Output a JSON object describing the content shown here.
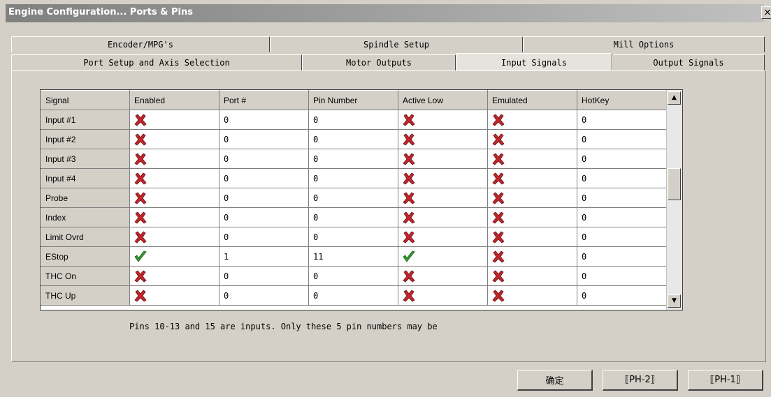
{
  "window": {
    "title": "Engine Configuration... Ports & Pins",
    "close": "×"
  },
  "tabs_row1": [
    {
      "label": "Encoder/MPG's"
    },
    {
      "label": "Spindle Setup"
    },
    {
      "label": "Mill Options"
    }
  ],
  "tabs_row2": [
    {
      "label": "Port Setup and Axis Selection",
      "active": false
    },
    {
      "label": "Motor Outputs",
      "active": false
    },
    {
      "label": "Input Signals",
      "active": true
    },
    {
      "label": "Output Signals",
      "active": false
    }
  ],
  "grid": {
    "headers": [
      "Signal",
      "Enabled",
      "Port #",
      "Pin Number",
      "Active Low",
      "Emulated",
      "HotKey"
    ],
    "rows": [
      {
        "signal": "Input #1",
        "enabled": "no",
        "port": "0",
        "pin": "0",
        "active_low": "no",
        "emulated": "no",
        "hotkey": "0"
      },
      {
        "signal": "Input #2",
        "enabled": "no",
        "port": "0",
        "pin": "0",
        "active_low": "no",
        "emulated": "no",
        "hotkey": "0"
      },
      {
        "signal": "Input #3",
        "enabled": "no",
        "port": "0",
        "pin": "0",
        "active_low": "no",
        "emulated": "no",
        "hotkey": "0"
      },
      {
        "signal": "Input #4",
        "enabled": "no",
        "port": "0",
        "pin": "0",
        "active_low": "no",
        "emulated": "no",
        "hotkey": "0"
      },
      {
        "signal": "Probe",
        "enabled": "no",
        "port": "0",
        "pin": "0",
        "active_low": "no",
        "emulated": "no",
        "hotkey": "0"
      },
      {
        "signal": "Index",
        "enabled": "no",
        "port": "0",
        "pin": "0",
        "active_low": "no",
        "emulated": "no",
        "hotkey": "0"
      },
      {
        "signal": "Limit Ovrd",
        "enabled": "no",
        "port": "0",
        "pin": "0",
        "active_low": "no",
        "emulated": "no",
        "hotkey": "0"
      },
      {
        "signal": "EStop",
        "enabled": "yes",
        "port": "1",
        "pin": "11",
        "active_low": "yes",
        "emulated": "no",
        "hotkey": "0"
      },
      {
        "signal": "THC On",
        "enabled": "no",
        "port": "0",
        "pin": "0",
        "active_low": "no",
        "emulated": "no",
        "hotkey": "0"
      },
      {
        "signal": "THC Up",
        "enabled": "no",
        "port": "0",
        "pin": "0",
        "active_low": "no",
        "emulated": "no",
        "hotkey": "0"
      }
    ]
  },
  "note": "Pins 10-13 and 15 are inputs. Only these 5 pin numbers may be",
  "buttons": [
    {
      "label": "确定"
    },
    {
      "label": "⟦PH-2⟧"
    },
    {
      "label": "⟦PH-1⟧"
    }
  ],
  "colors": {
    "cross": "#c0262c",
    "check": "#2f9b2f",
    "face": "#d4d0c8"
  },
  "icons": {
    "no": "red-x-icon",
    "yes": "green-check-icon"
  }
}
